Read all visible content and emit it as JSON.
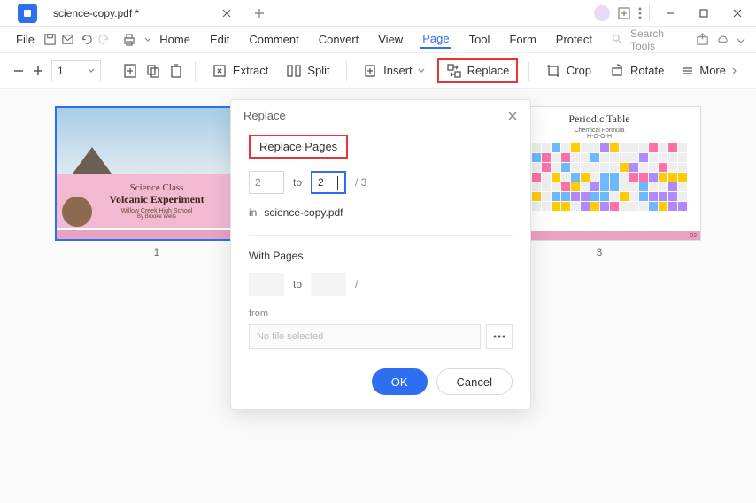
{
  "titlebar": {
    "filename": "science-copy.pdf *"
  },
  "menubar": {
    "file": "File",
    "items": [
      "Home",
      "Edit",
      "Comment",
      "Convert",
      "View",
      "Page",
      "Tool",
      "Form",
      "Protect"
    ],
    "active_index": 5,
    "search_placeholder": "Search Tools"
  },
  "toolbar": {
    "page_field": "1",
    "extract": "Extract",
    "split": "Split",
    "insert": "Insert",
    "replace": "Replace",
    "crop": "Crop",
    "rotate": "Rotate",
    "more": "More"
  },
  "thumbs": {
    "p1": {
      "num": "1",
      "line1": "Science Class",
      "line2": "Volcanic Experiment",
      "line3": "Willow Creek High School",
      "line4": "By Brooke Wells"
    },
    "p3": {
      "num": "3",
      "title": "Periodic Table",
      "sub1": "Chemical Formula",
      "sub2": "H-O-O-H",
      "badge": "02"
    }
  },
  "modal": {
    "title": "Replace",
    "section1": "Replace Pages",
    "from_val": "2",
    "to_label": "to",
    "to_val": "2",
    "total": "/ 3",
    "in_label": "in",
    "in_file": "science-copy.pdf",
    "section2": "With Pages",
    "slash": "/",
    "from_label": "from",
    "file_placeholder": "No file selected",
    "ok": "OK",
    "cancel": "Cancel"
  }
}
